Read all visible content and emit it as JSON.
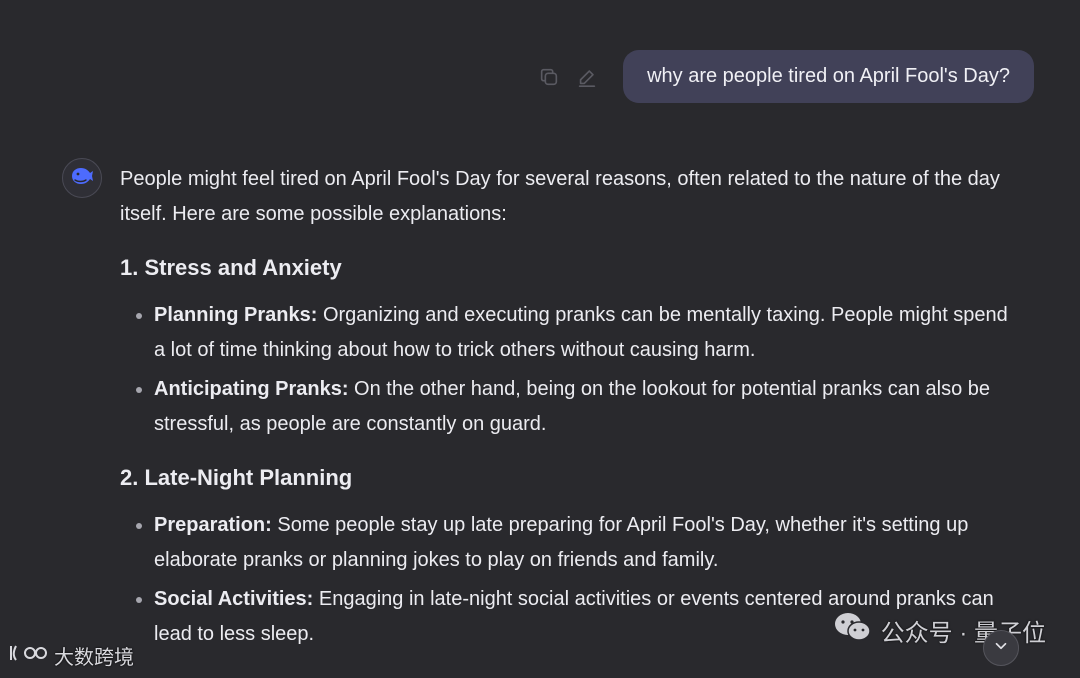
{
  "user_message": {
    "text": "why are people tired on April Fool's Day?"
  },
  "icons": {
    "copy": "copy-icon",
    "edit": "edit-icon",
    "avatar": "whale-logo-icon",
    "scroll_down": "chevron-down-icon"
  },
  "assistant": {
    "intro": "People might feel tired on April Fool's Day for several reasons, often related to the nature of the day itself. Here are some possible explanations:",
    "sections": [
      {
        "heading": "1. Stress and Anxiety",
        "items": [
          {
            "term": "Planning Pranks:",
            "text": "Organizing and executing pranks can be mentally taxing. People might spend a lot of time thinking about how to trick others without causing harm."
          },
          {
            "term": "Anticipating Pranks:",
            "text": "On the other hand, being on the lookout for potential pranks can also be stressful, as people are constantly on guard."
          }
        ]
      },
      {
        "heading": "2. Late-Night Planning",
        "items": [
          {
            "term": "Preparation:",
            "text": "Some people stay up late preparing for April Fool's Day, whether it's setting up elaborate pranks or planning jokes to play on friends and family."
          },
          {
            "term": "Social Activities:",
            "text": "Engaging in late-night social activities or events centered around pranks can lead to less sleep."
          }
        ]
      }
    ]
  },
  "watermarks": {
    "left": "大数跨境",
    "right": "公众号 · 量子位"
  },
  "colors": {
    "background": "#29292d",
    "user_bubble": "#414158",
    "accent": "#4d6bfe"
  }
}
